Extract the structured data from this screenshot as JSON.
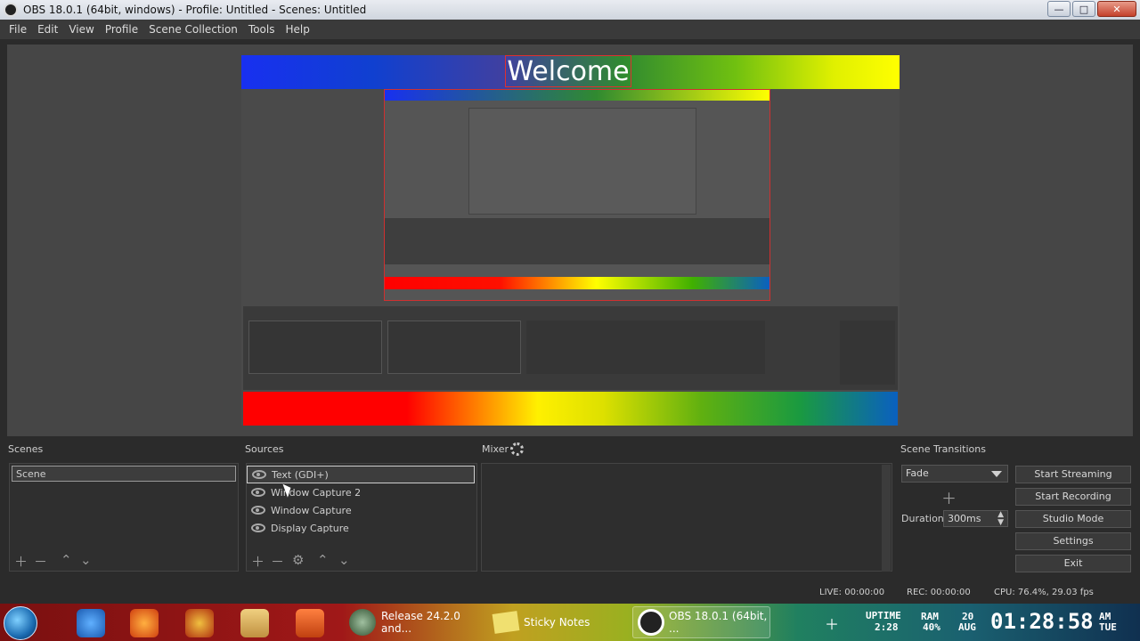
{
  "window": {
    "title": "OBS 18.0.1 (64bit, windows) - Profile: Untitled - Scenes: Untitled",
    "buttons": {
      "minimize": "—",
      "maximize": "□",
      "close": "✕"
    }
  },
  "menu": [
    "File",
    "Edit",
    "View",
    "Profile",
    "Scene Collection",
    "Tools",
    "Help"
  ],
  "preview": {
    "welcome_text": "Welcome"
  },
  "scenes": {
    "title": "Scenes",
    "items": [
      "Scene"
    ]
  },
  "sources": {
    "title": "Sources",
    "items": [
      "Text (GDI+)",
      "Window Capture 2",
      "Window Capture",
      "Display Capture"
    ]
  },
  "mixer": {
    "title": "Mixer"
  },
  "transitions": {
    "title": "Scene Transitions",
    "selected": "Fade",
    "duration_label": "Duration",
    "duration_value": "300ms"
  },
  "controls": [
    "Start Streaming",
    "Start Recording",
    "Studio Mode",
    "Settings",
    "Exit"
  ],
  "status": {
    "live": "LIVE: 00:00:00",
    "rec": "REC: 00:00:00",
    "cpu": "CPU: 76.4%, 29.03 fps"
  },
  "taskbar": {
    "tasks": [
      "Release 24.2.0 and...",
      "Sticky Notes",
      "OBS 18.0.1 (64bit, ..."
    ],
    "uptime_label": "UPTIME",
    "uptime_value": "2:28",
    "ram_label": "RAM",
    "ram_value": "40%",
    "date_day": "20",
    "date_month": "AUG",
    "time": "01:28:58",
    "ampm": "AM",
    "weekday": "TUE"
  }
}
